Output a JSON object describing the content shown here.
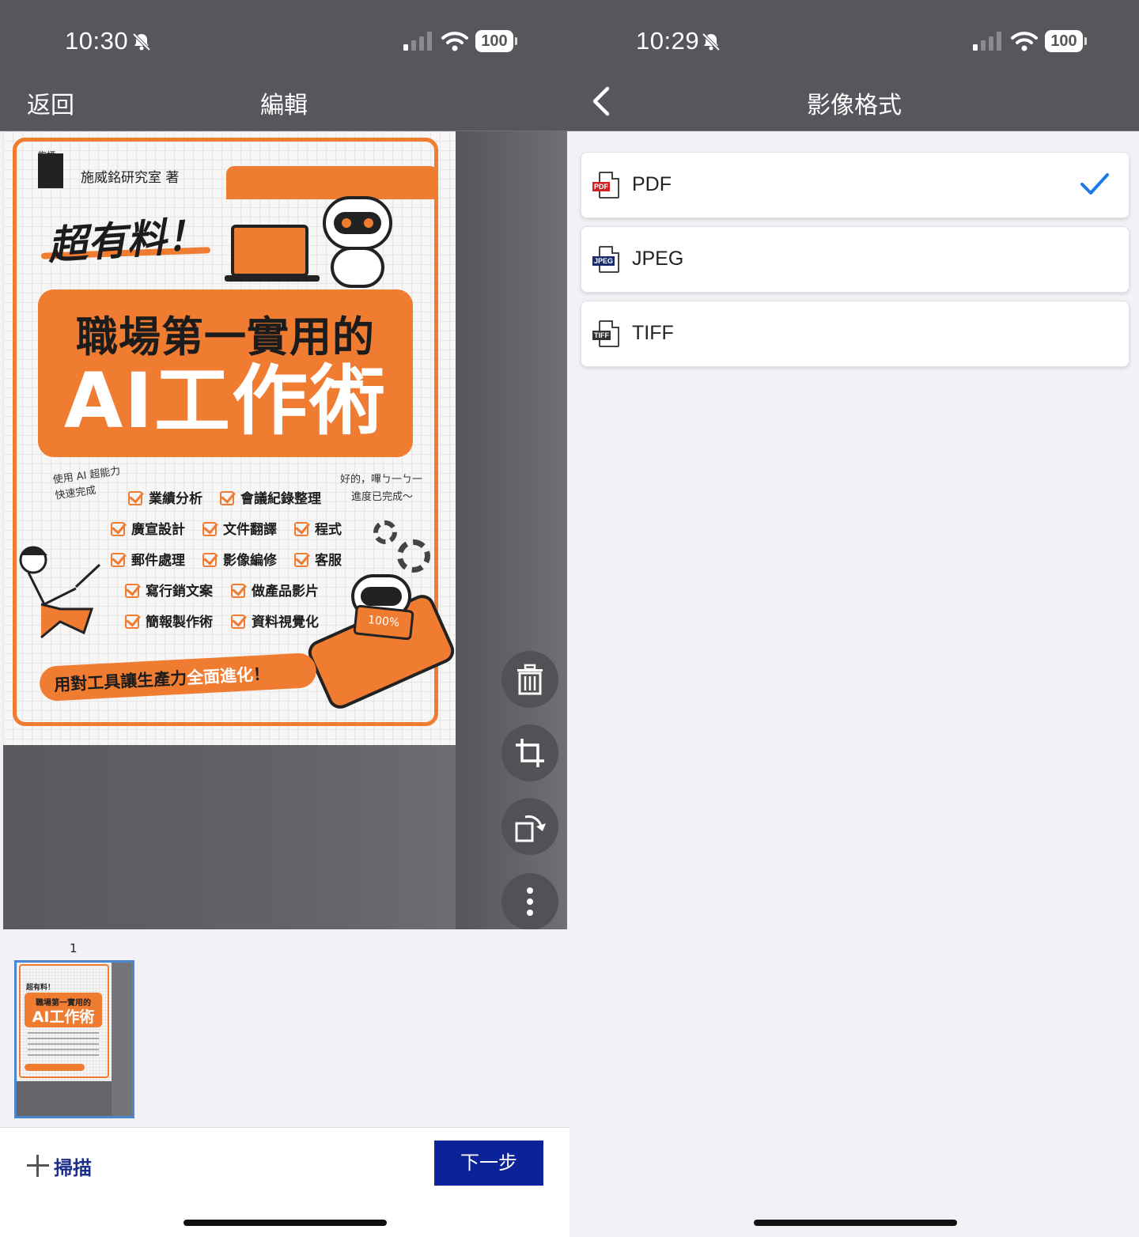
{
  "left": {
    "status": {
      "time": "10:30",
      "battery": "100"
    },
    "nav": {
      "back_label": "返回",
      "title": "編輯"
    },
    "book": {
      "publisher": "旗標",
      "author": "施威銘研究室 著",
      "subtitle": "超有料！",
      "title_line1": "職場第一實用的",
      "title_line2": "AI工作術",
      "intro_left": "使用 AI 超能力\n快速完成",
      "intro_right_1": "好的，嗶ㄅ一ㄅ一",
      "intro_right_2": "進度已完成～",
      "skills": [
        "業績分析",
        "會議紀錄整理",
        "廣宣設計",
        "文件翻譯",
        "程式",
        "郵件處理",
        "影像編修",
        "客服",
        "寫行銷文案",
        "做產品影片",
        "簡報製作術",
        "資料視覺化"
      ],
      "sign": "100%",
      "slogan_main": "用對工具讓生產力",
      "slogan_highlight": "全面進化",
      "slogan_end": "！"
    },
    "tools": [
      {
        "icon": "trash-icon"
      },
      {
        "icon": "crop-icon"
      },
      {
        "icon": "rotate-icon"
      },
      {
        "icon": "more-vertical-icon"
      }
    ],
    "thumbnails": [
      {
        "page": "1"
      }
    ],
    "thumb_book": {
      "subtitle": "超有料！",
      "title_line1": "職場第一實用的",
      "title_line2": "AI工作術"
    },
    "bottom": {
      "scan_label": "掃描",
      "next_label": "下一步"
    }
  },
  "right": {
    "status": {
      "time": "10:29",
      "battery": "100"
    },
    "nav": {
      "title": "影像格式"
    },
    "formats": [
      {
        "label": "PDF",
        "tag": "PDF",
        "tag_color": "#d42020",
        "selected": true
      },
      {
        "label": "JPEG",
        "tag": "JPEG",
        "tag_color": "#1a2a6e",
        "selected": false
      },
      {
        "label": "TIFF",
        "tag": "TIFF",
        "tag_color": "#333333",
        "selected": false
      }
    ]
  },
  "colors": {
    "bar": "#56565c",
    "accent": "#f07c32",
    "primary_button": "#0b2299",
    "check": "#1a7ae8"
  }
}
